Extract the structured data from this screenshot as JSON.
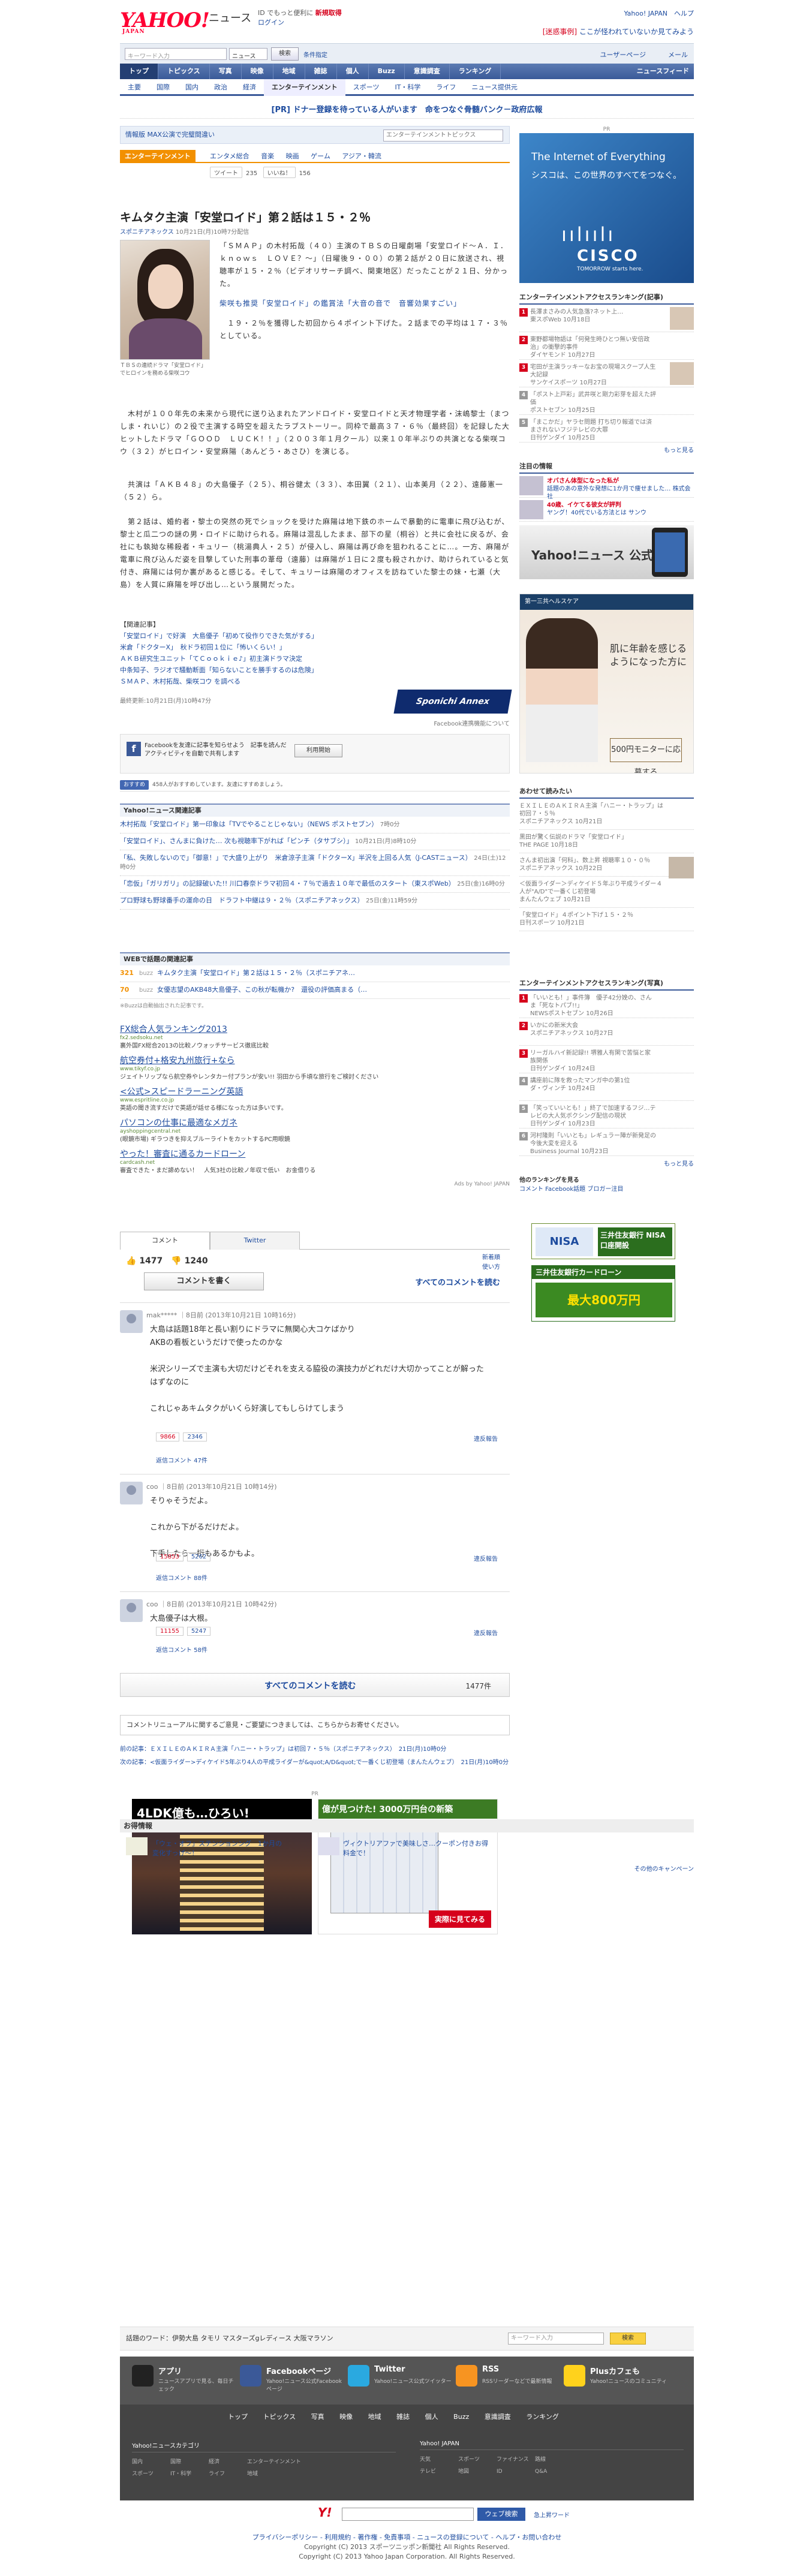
{
  "header": {
    "logo": "YAHOO!",
    "logo_sub": "JAPAN",
    "service": "ニュース",
    "promo_line1": "ID でもっと便利に",
    "promo_new": "新規取得",
    "promo_login": "ログイン",
    "top_links": "Yahoo! JAPAN　ヘルプ",
    "notice_red": "[迷惑事例]",
    "notice_link": "ここが怪われていないか見てみよう"
  },
  "search": {
    "placeholder": "キーワード入力",
    "select": "ニュース",
    "button": "検索",
    "advanced": "条件指定",
    "user": "ユーザーページ",
    "mail": "メール"
  },
  "gnav": {
    "items": [
      "トップ",
      "トピックス",
      "写真",
      "映像",
      "地域",
      "雑誌",
      "個人",
      "Buzz",
      "意識調査",
      "ランキング"
    ],
    "right": "ニュースフィード"
  },
  "subnav": {
    "items": [
      "主要",
      "国際",
      "国内",
      "政治",
      "経済",
      "エンターテインメント",
      "スポーツ",
      "IT・科学",
      "ライフ",
      "ニュース提供元"
    ]
  },
  "pr_line": "[PR] ドナー登録を待っている人がいます　命をつなぐ骨髄バンク－政府広報",
  "infobar": {
    "label": "情報版 MAX公演で完璧間違い",
    "select": "エンターテインメントトピックス"
  },
  "category": {
    "tag": "エンターテインメント",
    "tabs": [
      "エンタメ総合",
      "音楽",
      "映画",
      "ゲーム",
      "アジア・韓流"
    ]
  },
  "tools": {
    "tweet": "ツイート",
    "tweet_count": "235",
    "like": "いいね！",
    "like_count": "156"
  },
  "article": {
    "title": "キムタク主演「安堂ロイド」第２話は１５・２％",
    "source": "スポニチアネックス",
    "date": "10月21日(月)10時7分配信",
    "photo_caption": "ＴＢＳの連続ドラマ「安堂ロイド」でヒロインを務める柴咲コウ",
    "p1": "「ＳＭＡＰ」の木村拓哉（４０）主演のＴＢＳの日曜劇場「安堂ロイド～Ａ．Ｉ．　ｋｎｏｗｓ　ＬＯＶＥ？～」（日曜後９・００）の第２話が２０日に放送され、視聴率が１５・２％（ビデオリサーチ調べ、関東地区）だったことが２１日、分かった。",
    "p1_rel": "柴咲も推奨「安堂ロイド」の鑑賞法「大音の音で　音響効果すごい」",
    "p2": "　１９・２％を獲得した初回から４ポイント下げた。２話までの平均は１７・３％としている。",
    "p3": "　木村が１００年先の未来から現代に送り込まれたアンドロイド・安堂ロイドと天才物理学者・沫嶋黎士（まつしま・れいじ）の２役で主演する時空を超えたラブストーリー。同枠で最高３７・６％（最終回）を記録した大ヒットしたドラマ「ＧＯＯＤ　ＬＵＣＫ！！」（２００３年１月クール）以来１０年半ぶりの共演となる柴咲コウ（３２）がヒロイン・安堂麻陽（あんどう・あさひ）を演じる。",
    "p4": "　共演は「ＡＫＢ４８」の大島優子（２５）、桐谷健太（３３）、本田翼（２１）、山本美月（２２）、遠藤憲一（５２）ら。",
    "p5": "　第２話は、婚約者・黎士の突然の死でショックを受けた麻陽は地下鉄のホームで暴動的に電車に飛び込むが、黎士と瓜二つの謎の男・ロイドに助けられる。麻陽は混乱したまま、部下の星（桐谷）と共に会社に戻るが、会社にも執拗な稀殺者・キュリー（桃湯典人・２５）が侵入し、麻陽は再び命を狙われることに…。一方、麻陽が電車に飛び込んだ姿を目撃していた刑事の葦母（遠藤）は麻陽が１日に２度も殺されかけ、助けられていると気付き、麻陽には何か裏があると感じる。そして、キュリーは麻陽のオフィスを訪ねていた黎士の妹・七瀬（大島）を人質に麻陽を呼び出し…という展開だった。",
    "rel_header": "【関連記事】",
    "rel_links": [
      "「安堂ロイド」で好演　大島優子「初めて役作りできた気がする」",
      "米倉「ドクターX」　秋ドラ初回１位に「怖いくらい！」",
      "ＡＫＢ研究生ユニット「てＣｏｏｋｉｅ♪」初主演ドラマ決定",
      "中条知子、ラジオで騒動断面「知らないことを勝手するのは危険」",
      "ＳＭＡＰ、木村拓哉、柴咲コウ を調べる"
    ],
    "updated": "最終更新:10月21日(月)10時47分",
    "logo": "Sponichi Annex",
    "fb_comment": "Facebook連携機能について"
  },
  "fb": {
    "text": "Facebookを友達に記事を知らせよう　記事を読んだアクティビティを自動で共有します",
    "button": "利用開始"
  },
  "likebar": {
    "button": "おすすめ",
    "text": "458人がおすすめしています。友達にすすめましょう。"
  },
  "related": {
    "header": "Yahoo!ニュース関連記事",
    "items": [
      {
        "t": "木村拓哉「安堂ロイド」第一印象は「TVでやることじゃない」（NEWS ポストセブン）",
        "m": "7時0分"
      },
      {
        "t": "「安堂ロイド」、さんまに負けた… 次も視聴率下がれば「ピンチ（タサブシ）」",
        "m": "10月21日(月)8時10分"
      },
      {
        "t": "「私、失敗しないので」「御意！」で大盛り上がり　米倉涼子主演「ドクターX」半沢を上回る人気（J-CASTニュース）",
        "m": "24日(土)12時0分"
      },
      {
        "t": "「恋仮」「ガリガリ」の記録破いた!! 川口春奈ドラマ初回４・７％で過去１０年で最低のスタート（東スポWeb）",
        "m": "25日(金)16時0分"
      },
      {
        "t": "プロ野球も野球番手の運命の日　ドラフト中継は９・２％（スポニチアネックス）",
        "m": "25日(金)11時59分"
      }
    ]
  },
  "buzz": {
    "header": "WEBで話題の関連記事",
    "items": [
      {
        "n": "321",
        "u": "buzz",
        "t": "キムタク主演「安堂ロイド」第２話は１５・２％（スポニチアネ…"
      },
      {
        "n": "70",
        "u": "buzz",
        "t": "女優志望のAKB48大島優子、この秋が転機か?　還役の評価高まる（…"
      }
    ],
    "note": "※Buzzは自動抽出された記事です。"
  },
  "ads": [
    {
      "t": "FX総合人気ランキング2013",
      "u": "fx2.sedsoku.net",
      "d": "裏外国FX総合2013の比較ノウォッチサービス徹底比較"
    },
    {
      "t": "航空券付+格安九州旅行+なら",
      "u": "www.tikyf.co.jp",
      "d": "ジェイトリップなら航空券やレンタカー付プランが安い!! 羽田から手頃な旅行をご検討ください"
    },
    {
      "t": "<公式>スピードラーニング英語",
      "u": "www.espritline.co.jp",
      "d": "英語の聞き流すだけで英語が話せる様になった方は多いです。"
    },
    {
      "t": "パソコンの仕事に最適なメガネ",
      "u": "ayshoppingcentral.net",
      "d": "(眼鏡市場) ギラつきを抑えブルーライトをカットするPC用眼鏡"
    },
    {
      "t": "やった！審査に通るカードローン",
      "u": "cardcash.net",
      "d": "審査できた・まだ諦めない！　人気3社の比較ノ年収で低い　お金借りる"
    }
  ],
  "ads_note": "Ads by Yahoo! JAPAN",
  "comments": {
    "tab_comment": "コメント",
    "tab_twitter": "Twitter",
    "count_up": "1477",
    "count_dn": "1240",
    "write": "コメントを書く",
    "all_link": "すべてのコメントを読む",
    "opt1": "新着順",
    "opt2": "使い方",
    "items": [
      {
        "name": "mak*****",
        "meta": "｜8日前 (2013年10月21日 10時16分)",
        "text": "大島は話題18年と長い割りにドラマに無関心大コケばかり\nAKBの看板というだけで使ったのかな\n\n米沢シリーズで主演も大切だけどそれを支える脇役の演技力がどれだけ大切かってことが解ったはずなのに\n\nこれじゃあキムタクがいくら好演してもしらけてしまう",
        "up": "9866",
        "dn": "2346",
        "reply": "返信コメント 47件",
        "report": "違反報告"
      },
      {
        "name": "coo",
        "meta": "｜8日前 (2013年10月21日 10時14分)",
        "text": "そりゃそうだよ。\n\nこれから下がるだけだよ。\n\n下手したら一桁もあるかもよ。",
        "up": "15853",
        "dn": "5262",
        "reply": "返信コメント 88件",
        "report": "違反報告"
      },
      {
        "name": "coo",
        "meta": "｜8日前 (2013年10月21日 10時42分)",
        "text": "大島優子は大根。",
        "up": "11155",
        "dn": "5247",
        "reply": "返信コメント 58件",
        "report": "違反報告"
      }
    ],
    "seeall": "すべてのコメントを読む",
    "seeall_count": "1477件"
  },
  "renewal": "コメントリニューアルに関するご意見・ご要望につきましては、こちらからお寄せください。",
  "prevnext": {
    "prev": "前の記事：ＥＸＩＬＥのＡＫＩＲＡ主演「ハニー・トラップ」は初回７・５％（スポニチアネックス）　21日(月)10時0分",
    "next": "次の記事：<仮面ライダー>ディケイド5年ぶり4人の平成ライダーが&quot;A/D&quot;で一番くじ初登場（まんたんウェブ）　21日(月)10時0分"
  },
  "bigads": {
    "pr": "PR",
    "ad1_title": "4LDK億も…ひろい!",
    "ad2_title": "億が見つけた! 3000万円台の新築",
    "ad2_btn": "実際に見てみる"
  },
  "osusume": {
    "header": "お得情報",
    "items": [
      {
        "t1": "「ウェ・オフ」ステンションング　1か月の変化すっげ～！",
        "t2": "ヴィクトリアファで美味しさ…クーポン付きお得料金で！"
      }
    ],
    "more": "その他のキャンペーン"
  },
  "sidebar": {
    "pr": "PR",
    "cisco_l1": "The Internet of Everything",
    "cisco_l2": "シスコは、この世界のすべてをつなぐ。",
    "cisco_name": "CISCO",
    "cisco_tag": "TOMORROW starts here.",
    "rank_header": "エンターテインメントアクセスランキング(記事)",
    "rank": [
      {
        "no": "1",
        "t": "長澤まさみの人気急落?ネット上…",
        "s": "東スポWeb 10月18日"
      },
      {
        "no": "2",
        "t": "東野都場物語は「何発生時ひとつ無い安倍政治」の衝撃的事件",
        "s": "ダイヤモンド 10月27日"
      },
      {
        "no": "3",
        "t": "宅田が主演ラッキーなお宝の現場スクープ人生大記録",
        "s": "サンケイスポーツ 10月27日"
      },
      {
        "no": "4",
        "t": "「ポスト上戸彩」武井咲と剛力彩芽を超えた評価",
        "s": "ポストセブン 10月25日"
      },
      {
        "no": "5",
        "t": "「まこかだ」ヤラセ問題 打ち切り報道では済まされないフジテレビの大罪",
        "s": "日刊ゲンダイ 10月25日"
      }
    ],
    "more": "もっと見る",
    "chui_header": "注目の情報",
    "chui": [
      {
        "b": "オバさん体型になった私が",
        "t": "話題のあの意外な発想に1か月で痩せました…",
        "s": "株式会社"
      },
      {
        "b": "40歳、イケてる彼女が評判",
        "t": "ヤング！40代でいる方法とは",
        "s": "サンウ"
      }
    ],
    "app_title": "Yahoo!ニュース 公式アプリ",
    "nind_top": "第一三共ヘルスケア",
    "nind_h": "肌に年齢を感じるようになった方に",
    "nind_btn": "500円モニターに応募する",
    "awase_header": "あわせて読みたい",
    "awase": [
      {
        "t": "ＥＸＩＬＥのＡＫＩＲＡ主演「ハニー・トラップ」は初回７・５％",
        "s": "スポニチアネックス 10月21日"
      },
      {
        "t": "黒田が驚く伝説のドラマ「安堂ロイド」",
        "s": "THE PAGE 10月18日"
      },
      {
        "t": "さんま初出演「何科」、数上昇 視聴率１０・０％",
        "s": "スポニチアネックス 10月22日"
      },
      {
        "t": "＜仮面ライダー＞ディケイド５年ぶり平成ライダー４人が\"A/D\"で一番くじ初登場",
        "s": "まんたんウェブ 10月21日"
      },
      {
        "t": "「安堂ロイド」４ポイント下げ１５・２％",
        "s": "日刊スポーツ 10月21日"
      }
    ],
    "rank2_header": "エンターテインメントアクセスランキング(写真)",
    "rank2": [
      {
        "no": "1",
        "t": "「いいとも！」事件簿　優子42分娩の、さんま「死なトパブ!!」",
        "s": "NEWSポストセブン 10月26日"
      },
      {
        "no": "2",
        "t": "いかにの新米大会",
        "s": "スポニチアネックス 10月27日"
      },
      {
        "no": "3",
        "t": "リーガルハイ新記録!! 堺雅人有閑で苦悩と家族関係",
        "s": "日刊ゲンダイ 10月24日"
      },
      {
        "no": "4",
        "t": "講座前に隊を救ったマンガ中の第1位",
        "s": "ダ・ヴィンチ 10月24日"
      },
      {
        "no": "5",
        "t": "「笑っていいとも！」終了で加速するフジ…テレビの大人気ボクシング配信の現状",
        "s": "日刊ゲンダイ 10月23日"
      },
      {
        "no": "6",
        "t": "河村隆則「いいとも」レギュラー陣が新発足の今後大変を迎える",
        "s": "Business Journal 10月23日"
      }
    ],
    "more2": "もっと見る",
    "other": "他のランキングを見る",
    "other_links": "コメント  Facebook話題  ブロガー注目",
    "sp1_l": "NISA",
    "sp1_r": "三井住友銀行 NISA口座開設",
    "sp2_h": "三井住友銀行カードローン",
    "sp2_b": "最大800万円"
  },
  "footer": {
    "word_label": "話題のワード：伊勢大島  タモリ  マスターズgレディース  大阪マラソン",
    "word_placeholder": "キーワード入力",
    "word_btn": "検索",
    "apps": [
      {
        "t": "アプリ",
        "d": "ニュースアプリで見る、毎日チェック"
      },
      {
        "t": "Facebookページ",
        "d": "Yahoo!ニュース公式Facebookページ"
      },
      {
        "t": "Twitter",
        "d": "Yahoo!ニュース公式ツイッター"
      },
      {
        "t": "RSS",
        "d": "RSSリーダーなどで最新情報"
      },
      {
        "t": "Plusカフェも",
        "d": "Yahoo!ニュースのコミュニティ"
      }
    ],
    "nav": [
      "トップ",
      "トピックス",
      "写真",
      "映像",
      "地域",
      "雑誌",
      "個人",
      "Buzz",
      "意識調査",
      "ランキング"
    ],
    "col1_h": "Yahoo!ニュースカテゴリ",
    "col1": [
      "国内",
      "国際",
      "経済",
      "エンターテインメント",
      "スポーツ",
      "IT・科学",
      "ライフ",
      "地域"
    ],
    "col2_h": "Yahoo! JAPAN",
    "col2": [
      "天気",
      "スポーツ",
      "ファイナンス",
      "路線",
      "テレビ",
      "地図",
      "ID",
      "Q&A"
    ],
    "bottom_btn": "ウェブ検索",
    "bottom_opt": "急上昇ワード",
    "legal1": "プライバシーポリシー - 利用規約 - 著作権 - 免責事項 - ニュースの登録について - ヘルプ・お問い合わせ",
    "legal2": "Copyright (C) 2013 スポーツニッポン新聞社 All Rights Reserved.",
    "legal3": "Copyright (C) 2013 Yahoo Japan Corporation. All Rights Reserved."
  }
}
